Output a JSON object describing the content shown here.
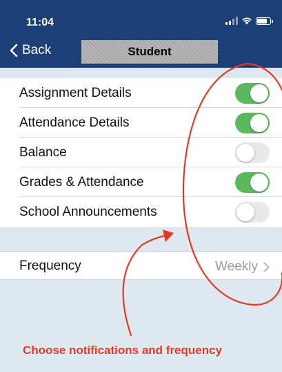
{
  "status_bar": {
    "time": "11:04",
    "signal_icon": "cellular-signal-icon",
    "wifi_icon": "wifi-icon",
    "battery_icon": "battery-icon"
  },
  "nav": {
    "back_label": "Back",
    "back_icon": "chevron-left-icon",
    "title": "Student"
  },
  "settings": {
    "toggles": [
      {
        "label": "Assignment Details",
        "on": true
      },
      {
        "label": "Attendance Details",
        "on": true
      },
      {
        "label": "Balance",
        "on": false
      },
      {
        "label": "Grades & Attendance",
        "on": true
      },
      {
        "label": "School Announcements",
        "on": false
      }
    ],
    "frequency": {
      "label": "Frequency",
      "value": "Weekly",
      "icon": "chevron-right-icon"
    }
  },
  "annotation": {
    "text": "Choose notifications and frequency"
  },
  "colors": {
    "nav_bg": "#1d3f77",
    "toggle_on": "#5cb85c",
    "toggle_off": "#e9e9eb",
    "page_bg": "#dde8f0",
    "annotation": "#e5391f"
  }
}
